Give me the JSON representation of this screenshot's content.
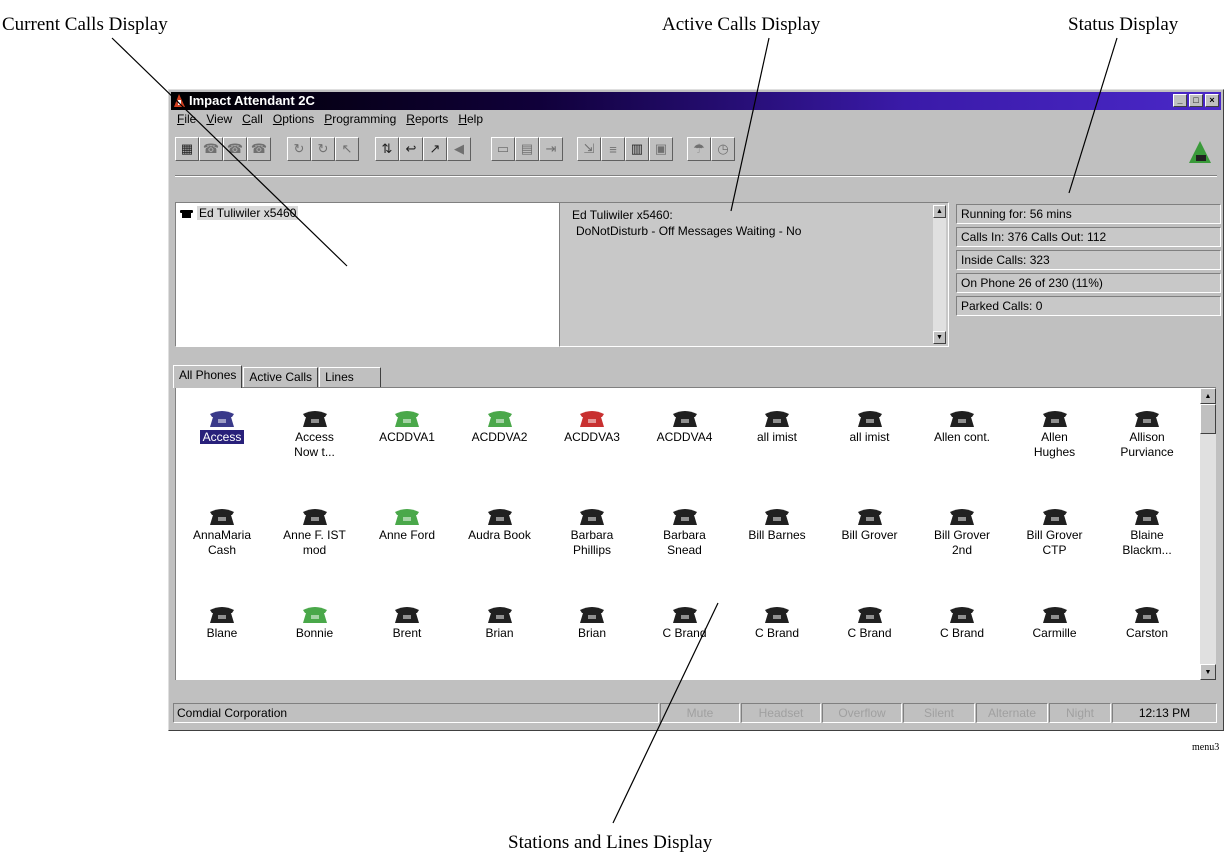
{
  "callouts": {
    "current_calls": "Current Calls Display",
    "active_calls": "Active Calls Display",
    "status": "Status Display",
    "stations": "Stations and Lines Display",
    "tag": "menu3"
  },
  "window": {
    "title": "Impact Attendant 2C",
    "min_glyph": "_",
    "max_glyph": "□",
    "close_glyph": "×"
  },
  "menu": [
    {
      "first": "F",
      "rest": "ile"
    },
    {
      "first": "V",
      "rest": "iew"
    },
    {
      "first": "C",
      "rest": "all"
    },
    {
      "first": "O",
      "rest": "ptions"
    },
    {
      "first": "P",
      "rest": "rogramming"
    },
    {
      "first": "R",
      "rest": "eports"
    },
    {
      "first": "H",
      "rest": "elp"
    }
  ],
  "toolbar_icons": [
    "grid-icon",
    "phone-icon",
    "phone-icon",
    "phone-icon",
    "transfer-icon",
    "transfer-icon",
    "hook-icon",
    "conference-icon",
    "hold-icon",
    "flash-icon",
    "speaker-icon",
    "directory-icon",
    "voicemail-icon",
    "forward-icon",
    "park-icon",
    "settings-icon",
    "calendar-icon",
    "monitor-icon",
    "help-icon",
    "clock-icon",
    "logo-icon"
  ],
  "current_calls": {
    "entry": "Ed Tuliwiler x5460"
  },
  "active_calls": {
    "line1": "Ed Tuliwiler x5460:",
    "line2": "DoNotDisturb - Off  Messages Waiting - No"
  },
  "status": {
    "running": "Running for: 56 mins",
    "calls": "Calls In: 376  Calls Out: 112",
    "inside": "Inside Calls: 323",
    "on_phone": "On Phone 26 of 230 (11%)",
    "parked": "Parked Calls: 0"
  },
  "tabs": [
    "All Phones",
    "Active Calls",
    "Lines"
  ],
  "phones": [
    {
      "l1": "Access",
      "l2": "",
      "color": "#3a3a8a",
      "sel": true
    },
    {
      "l1": "Access",
      "l2": "Now t...",
      "color": "#202020"
    },
    {
      "l1": "ACDDVA1",
      "l2": "",
      "color": "#4aa84a"
    },
    {
      "l1": "ACDDVA2",
      "l2": "",
      "color": "#4aa84a"
    },
    {
      "l1": "ACDDVA3",
      "l2": "",
      "color": "#c83030"
    },
    {
      "l1": "ACDDVA4",
      "l2": "",
      "color": "#202020"
    },
    {
      "l1": "all imist",
      "l2": "",
      "color": "#202020"
    },
    {
      "l1": "all imist",
      "l2": "",
      "color": "#202020"
    },
    {
      "l1": "Allen cont.",
      "l2": "",
      "color": "#202020"
    },
    {
      "l1": "Allen",
      "l2": "Hughes",
      "color": "#202020"
    },
    {
      "l1": "Allison",
      "l2": "Purviance",
      "color": "#202020"
    },
    {
      "l1": "AnnaMaria",
      "l2": "Cash",
      "color": "#202020"
    },
    {
      "l1": "Anne F. IST",
      "l2": "mod",
      "color": "#202020"
    },
    {
      "l1": "Anne Ford",
      "l2": "",
      "color": "#4aa84a"
    },
    {
      "l1": "Audra Book",
      "l2": "",
      "color": "#202020"
    },
    {
      "l1": "Barbara",
      "l2": "Phillips",
      "color": "#202020"
    },
    {
      "l1": "Barbara",
      "l2": "Snead",
      "color": "#202020"
    },
    {
      "l1": "Bill Barnes",
      "l2": "",
      "color": "#202020"
    },
    {
      "l1": "Bill Grover",
      "l2": "",
      "color": "#202020"
    },
    {
      "l1": "Bill Grover",
      "l2": "2nd",
      "color": "#202020"
    },
    {
      "l1": "Bill Grover",
      "l2": "CTP",
      "color": "#202020"
    },
    {
      "l1": "Blaine",
      "l2": "Blackm...",
      "color": "#202020"
    },
    {
      "l1": "Blane",
      "l2": "",
      "color": "#202020"
    },
    {
      "l1": "Bonnie",
      "l2": "",
      "color": "#4aa84a"
    },
    {
      "l1": "Brent",
      "l2": "",
      "color": "#202020"
    },
    {
      "l1": "Brian",
      "l2": "",
      "color": "#202020"
    },
    {
      "l1": "Brian",
      "l2": "",
      "color": "#202020"
    },
    {
      "l1": "C Brand",
      "l2": "",
      "color": "#202020"
    },
    {
      "l1": "C Brand",
      "l2": "",
      "color": "#202020"
    },
    {
      "l1": "C Brand",
      "l2": "",
      "color": "#202020"
    },
    {
      "l1": "C Brand",
      "l2": "",
      "color": "#202020"
    },
    {
      "l1": "Carmille",
      "l2": "",
      "color": "#202020"
    },
    {
      "l1": "Carston",
      "l2": "",
      "color": "#202020"
    }
  ],
  "statusbar": {
    "company": "Comdial Corporation",
    "indicators": [
      "Mute",
      "Headset",
      "Overflow",
      "Silent",
      "Alternate",
      "Night"
    ],
    "time": "12:13 PM"
  }
}
